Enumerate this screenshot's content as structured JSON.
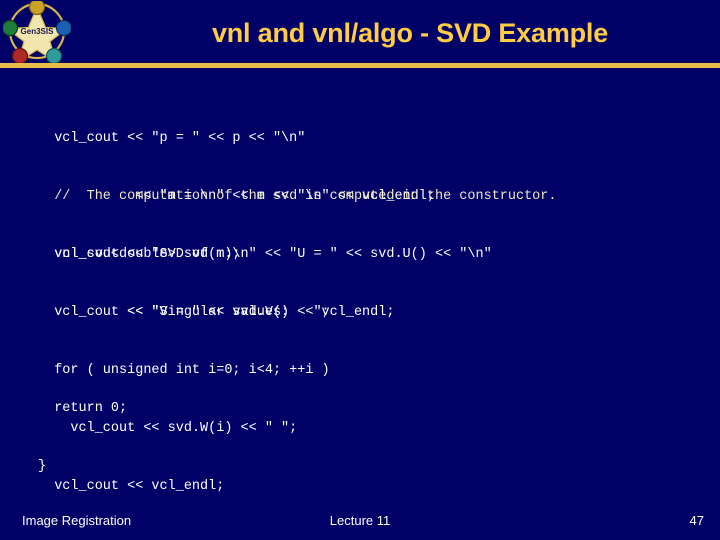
{
  "slide": {
    "background_color": "#000066",
    "title": "vnl and vnl/algo - SVD Example",
    "title_color": "#ffcc44",
    "divider_color": "#e8bd4a"
  },
  "logo": {
    "name": "gensis-star-emblem",
    "center_text": "Gen3SIS",
    "star_color": "#f2e6b0",
    "ring_color": "#d8b44a",
    "node_colors": [
      "#1f7d3c",
      "#1d5fb5",
      "#2e9c9c",
      "#b02828",
      "#c9a227"
    ]
  },
  "code": {
    "text_color": "#ffffff",
    "comment_color": "#efe7c4",
    "blocks": [
      {
        "id": "print-p-and-m",
        "lines": [
          "  vcl_cout << \"p = \" << p << \"\\n\"",
          "            << \"m = \\n\" << m << \"\\n\" << vcl_endl;"
        ]
      },
      {
        "id": "svd-construction",
        "lines": [
          "  //  The computation of the svd is computed in the constructor.",
          "  vnl_svd<double> svd(m);"
        ],
        "comment_line_indices": [
          0
        ]
      },
      {
        "id": "print-u-and-v",
        "lines": [
          "  vcl_cout << \"SVD of m:\\n\" << \"U = \" << svd.U() << \"\\n\"",
          "           << \"V = \" << svd.V() << vcl_endl;"
        ]
      },
      {
        "id": "print-singular-values",
        "lines": [
          "  vcl_cout << \"Singular values:   \";",
          "  for ( unsigned int i=0; i<4; ++i )",
          "    vcl_cout << svd.W(i) << \" \";",
          "  vcl_cout << vcl_endl;"
        ]
      },
      {
        "id": "return-and-close",
        "lines": [
          "  return 0;",
          "}"
        ]
      }
    ]
  },
  "footer": {
    "left": "Image Registration",
    "center": "Lecture 11",
    "page_number": "47"
  }
}
